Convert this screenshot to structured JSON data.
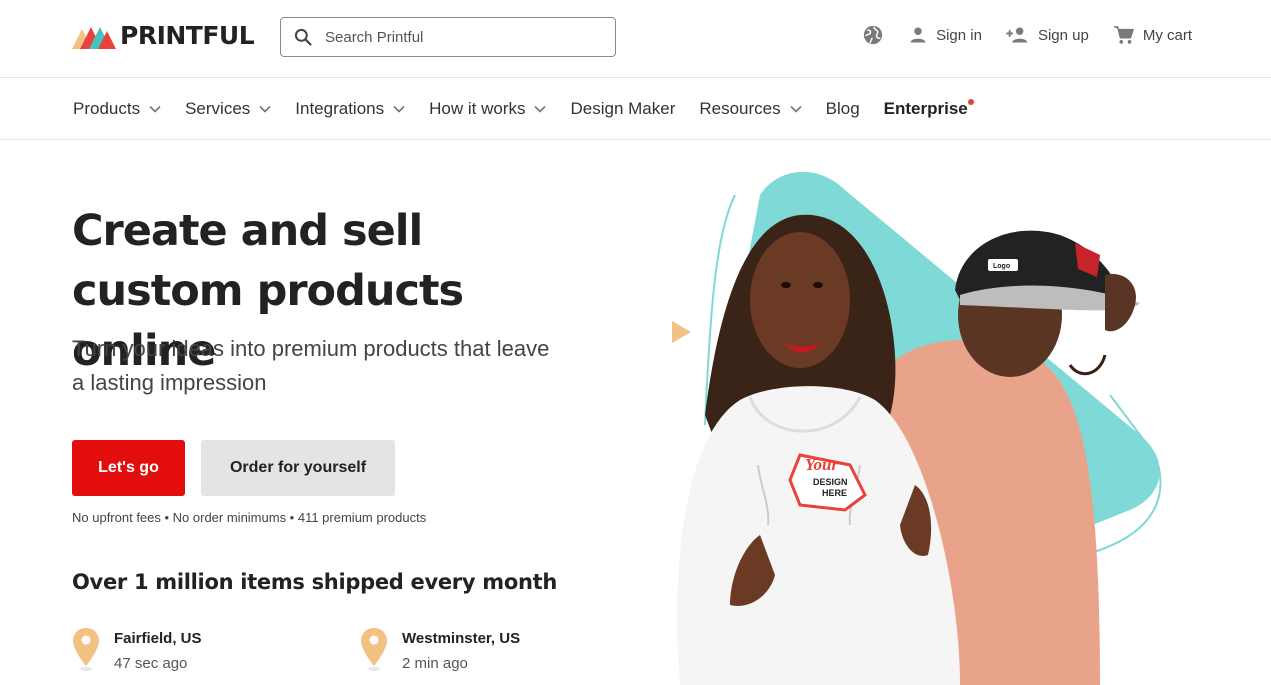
{
  "brand": {
    "name": "PRINTFUL"
  },
  "header": {
    "search_placeholder": "Search Printful",
    "actions": [
      {
        "label": "",
        "icon": "globe-icon"
      },
      {
        "label": "Sign in",
        "icon": "user-icon"
      },
      {
        "label": "Sign up",
        "icon": "add-user-icon"
      },
      {
        "label": "My cart",
        "icon": "cart-icon"
      }
    ]
  },
  "nav": {
    "items": [
      {
        "label": "Products",
        "has_dropdown": true
      },
      {
        "label": "Services",
        "has_dropdown": true
      },
      {
        "label": "Integrations",
        "has_dropdown": true
      },
      {
        "label": "How it works",
        "has_dropdown": true
      },
      {
        "label": "Design Maker",
        "has_dropdown": false
      },
      {
        "label": "Resources",
        "has_dropdown": true
      },
      {
        "label": "Blog",
        "has_dropdown": false
      },
      {
        "label": "Enterprise",
        "has_dropdown": false
      }
    ]
  },
  "hero": {
    "title": "Create and sell custom products online",
    "subtitle": "Turn your ideas into premium products that leave a lasting impression",
    "primary_button": "Let's go",
    "secondary_button": "Order for yourself",
    "fine_print": "No upfront fees • No order minimums • 411 premium products",
    "art_text": {
      "line1": "Your",
      "line2": "DESIGN",
      "line3": "HERE",
      "cap_logo": "Logo"
    }
  },
  "shipping": {
    "title": "Over 1 million items shipped every month",
    "items": [
      {
        "city": "Fairfield, US",
        "time": "47 sec ago"
      },
      {
        "city": "Westminster, US",
        "time": "2 min ago"
      }
    ]
  },
  "colors": {
    "accent": "#e30d0d",
    "teal": "#7fd9d6",
    "pin": "#f3c283",
    "notification": "#e8423a"
  }
}
